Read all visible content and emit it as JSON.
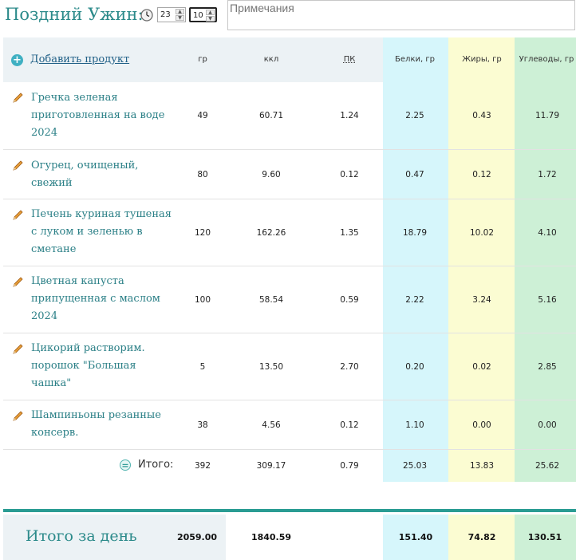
{
  "meal": {
    "title": "Поздний Ужин:",
    "time": {
      "hours": "23",
      "minutes": "10"
    },
    "notes_placeholder": "Примечания"
  },
  "header": {
    "add_product_label": "Добавить продукт",
    "col_grams": "гр",
    "col_kcal": "ккл",
    "col_pk": "ПК",
    "col_protein": "Белки, гр",
    "col_fat": "Жиры, гр",
    "col_carbs": "Углеводы, гр"
  },
  "products": [
    {
      "name": "Гречка зеленая приготовленная на воде 2024",
      "grams": "49",
      "kcal": "60.71",
      "pk": "1.24",
      "protein": "2.25",
      "fat": "0.43",
      "carbs": "11.79"
    },
    {
      "name": "Огурец, очищеный, свежий",
      "grams": "80",
      "kcal": "9.60",
      "pk": "0.12",
      "protein": "0.47",
      "fat": "0.12",
      "carbs": "1.72"
    },
    {
      "name": "Печень куриная тушеная с луком и зеленью в сметане",
      "grams": "120",
      "kcal": "162.26",
      "pk": "1.35",
      "protein": "18.79",
      "fat": "10.02",
      "carbs": "4.10"
    },
    {
      "name": "Цветная капуста припущенная с маслом 2024",
      "grams": "100",
      "kcal": "58.54",
      "pk": "0.59",
      "protein": "2.22",
      "fat": "3.24",
      "carbs": "5.16"
    },
    {
      "name": "Цикорий растворим. порошок \"Большая чашка\"",
      "grams": "5",
      "kcal": "13.50",
      "pk": "2.70",
      "protein": "0.20",
      "fat": "0.02",
      "carbs": "2.85"
    },
    {
      "name": "Шампиньоны резанные консерв.",
      "grams": "38",
      "kcal": "4.56",
      "pk": "0.12",
      "protein": "1.10",
      "fat": "0.00",
      "carbs": "0.00"
    }
  ],
  "meal_total": {
    "label": "Итого:",
    "grams": "392",
    "kcal": "309.17",
    "pk": "0.79",
    "protein": "25.03",
    "fat": "13.83",
    "carbs": "25.62"
  },
  "day_total": {
    "label": "Итого за день",
    "grams": "2059.00",
    "kcal": "1840.59",
    "protein": "151.40",
    "fat": "74.82",
    "carbs": "130.51"
  },
  "colors": {
    "accent_teal": "#2b8a8a",
    "protein_bg": "#d6f6fb",
    "fat_bg": "#fbfcd2",
    "carbs_bg": "#cdf0d6",
    "header_bg": "#ecf2f5"
  },
  "icons": {
    "clock": "clock-icon",
    "add": "add-product-icon",
    "edit": "pencil-icon",
    "total": "equals-icon"
  }
}
